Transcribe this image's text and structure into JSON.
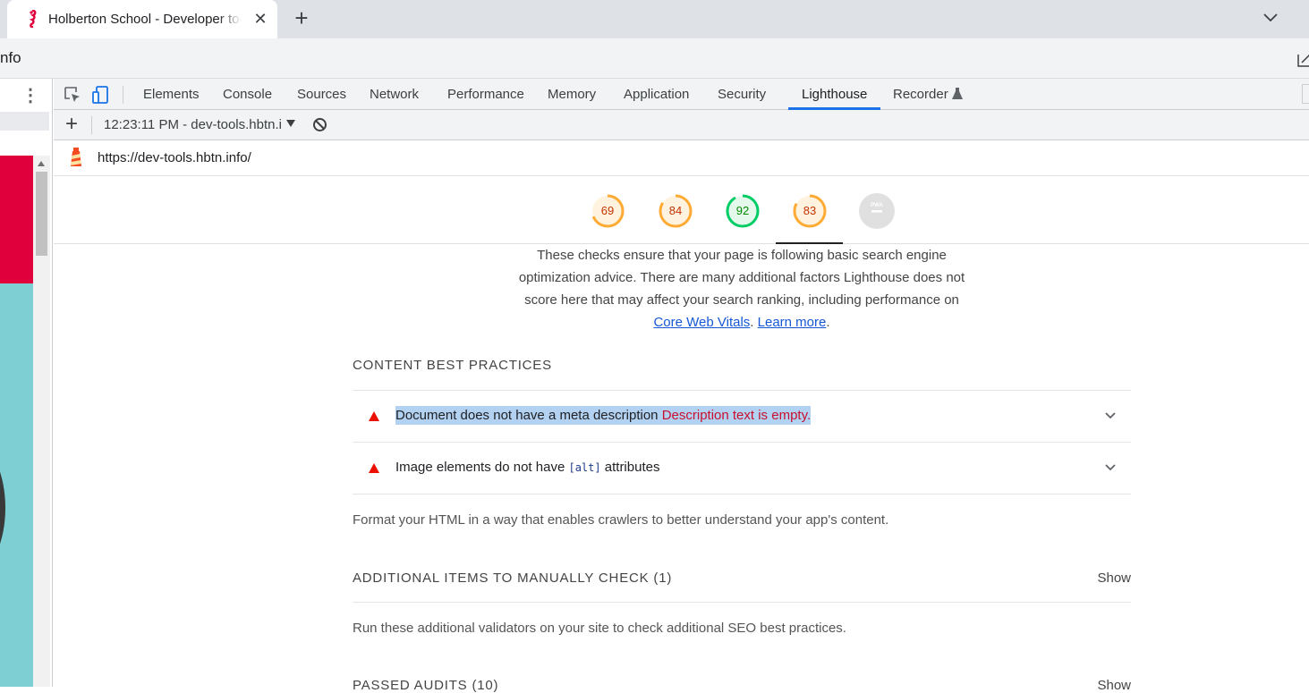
{
  "browser": {
    "tab_title": "Holberton School - Developer tools",
    "tab_close": "✕",
    "new_tab": "+",
    "address_text": "nfo"
  },
  "devtools": {
    "tabs": [
      "Elements",
      "Console",
      "Sources",
      "Network",
      "Performance",
      "Memory",
      "Application",
      "Security",
      "Lighthouse",
      "Recorder"
    ],
    "active_tab": "Lighthouse",
    "report_label": "12:23:11 PM - dev-tools.hbtn.i",
    "new_report": "+",
    "url": "https://dev-tools.hbtn.info/"
  },
  "scores": [
    {
      "value": "69",
      "fraction": 0.69,
      "color": "#fa3",
      "text_color": "#c33300",
      "track": "#fff3e0"
    },
    {
      "value": "84",
      "fraction": 0.84,
      "color": "#fa3",
      "text_color": "#c33300",
      "track": "#fff3e0"
    },
    {
      "value": "92",
      "fraction": 0.92,
      "color": "#0c6",
      "text_color": "#008800",
      "track": "#e5f8ec"
    },
    {
      "value": "83",
      "fraction": 0.83,
      "color": "#fa3",
      "text_color": "#c33300",
      "track": "#fff3e0"
    },
    {
      "value": "PWA",
      "fraction": 0,
      "color": "#ccc",
      "text_color": "#fff",
      "track": "#e0e0e0"
    }
  ],
  "report": {
    "desc_line1": "These checks ensure that your page is following basic search engine",
    "desc_line2": "optimization advice. There are many additional factors Lighthouse does not",
    "desc_line3": "score here that may affect your search ranking, including performance on",
    "link1": "Core Web Vitals",
    "link_sep": ". ",
    "link2": "Learn more",
    "link_end": ".",
    "group1_title": "Content Best Practices",
    "audit1_title": "Document does not have a meta description",
    "audit1_error": "Description text is empty.",
    "audit2_pre": "Image elements do not have ",
    "audit2_code": "[alt]",
    "audit2_post": " attributes",
    "group1_desc": "Format your HTML in a way that enables crawlers to better understand your app's content.",
    "group2_title": "Additional items to manually check (1)",
    "show_label": "Show",
    "group2_desc": "Run these additional validators on your site to check additional SEO best practices.",
    "group3_title": "Passed audits (10)"
  }
}
